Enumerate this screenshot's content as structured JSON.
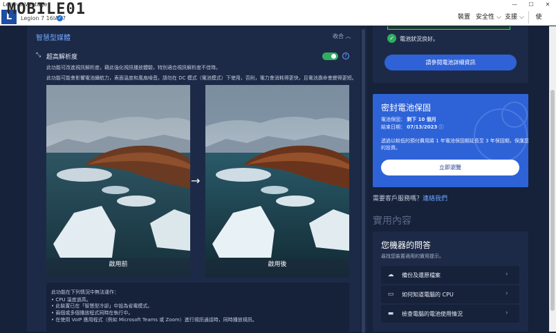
{
  "window": {
    "title": "Lenovo Vantage"
  },
  "watermark": "MOBILE01",
  "device": {
    "name": "Legion 7 16IAX7"
  },
  "nav": {
    "devices": "裝置",
    "security": "安全性 ⌵",
    "support": "支援 ⌵",
    "avatar": "使"
  },
  "smart_engine": {
    "section_title": "智慧型媒體",
    "collapse_label": "收合",
    "feature_title": "超高解析度",
    "toggle_on": true,
    "desc1": "此功能可改進視訊解析度，藉此強化視訊播放體驗，特別適合視訊解析度不佳時。",
    "desc2": "此功能可能會影響電池續航力，表面溫度和風扇噪音。請勿在 DC 模式（電池模式）下使用，否則，電力會消耗得更快，且電池壽命會變得更短。",
    "before_label": "啟用前",
    "after_label": "啟用後",
    "notes": [
      "此功能在下列情況中無法運作：",
      "• CPU 溫度過高。",
      "• 此裝置已在「智慧型冷卻」中設為省電模式。",
      "• 兩個或多個播放程式同時在執行中。",
      "• 在使用 VoIP 應用程式（例如 Microsoft Teams 或 Zoom）進行視訊通話時，同時播放視訊。"
    ]
  },
  "battery": {
    "status_text": "電池狀況良好。",
    "details_button": "請參閱電池詳細資訊"
  },
  "sealed_battery": {
    "title": "密封電池保固",
    "warranty_label": "電池保固：",
    "warranty_value": "剩下 10 個月",
    "end_label": "結束日期：",
    "end_value": "07/13/2023",
    "desc1": "透過以較低的預付費用將 1 年電池保固期延長至 3 年保固期，保護您",
    "desc2": "的投資。",
    "buy_button": "立即瀏覽"
  },
  "support": {
    "text": "需要客戶服務嗎？",
    "link": "連絡我們"
  },
  "useful": {
    "heading": "實用內容",
    "card_title": "您機器的問答",
    "card_subtitle": "尋找您裝置適用的實用提示。",
    "items": [
      {
        "label": "備份及還原檔案",
        "icon": "cloud-icon"
      },
      {
        "label": "如何知道電腦的 CPU",
        "icon": "laptop-icon"
      },
      {
        "label": "檢查電腦的電池使用情況",
        "icon": "battery-icon"
      }
    ]
  },
  "colors": {
    "accent": "#2f62d6",
    "success": "#2fae5f",
    "panel": "#1d2a47",
    "background": "#16213a"
  }
}
